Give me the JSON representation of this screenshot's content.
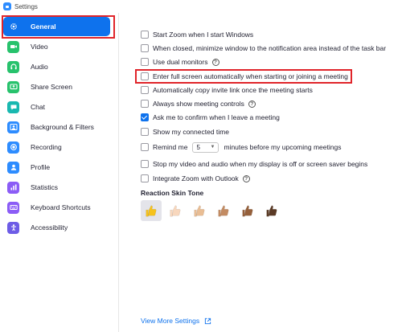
{
  "window": {
    "title": "Settings"
  },
  "sidebar": {
    "items": [
      {
        "label": "General",
        "icon": "gear-icon",
        "color": "#0e72ed",
        "active": true
      },
      {
        "label": "Video",
        "icon": "video-camera-icon",
        "color": "#27c26c"
      },
      {
        "label": "Audio",
        "icon": "headphones-icon",
        "color": "#27c26c"
      },
      {
        "label": "Share Screen",
        "icon": "share-screen-icon",
        "color": "#27c26c"
      },
      {
        "label": "Chat",
        "icon": "chat-bubble-icon",
        "color": "#19b8b0"
      },
      {
        "label": "Background & Filters",
        "icon": "person-background-icon",
        "color": "#2d8cff"
      },
      {
        "label": "Recording",
        "icon": "record-icon",
        "color": "#2d8cff"
      },
      {
        "label": "Profile",
        "icon": "profile-icon",
        "color": "#2d8cff"
      },
      {
        "label": "Statistics",
        "icon": "statistics-icon",
        "color": "#8b5cf6"
      },
      {
        "label": "Keyboard Shortcuts",
        "icon": "keyboard-icon",
        "color": "#8b5cf6"
      },
      {
        "label": "Accessibility",
        "icon": "accessibility-icon",
        "color": "#6d5ce6"
      }
    ]
  },
  "general": {
    "options": [
      {
        "label": "Start Zoom when I start Windows",
        "checked": false
      },
      {
        "label": "When closed, minimize window to the notification area instead of the task bar",
        "checked": false
      },
      {
        "label": "Use dual monitors",
        "checked": false,
        "help": true
      },
      {
        "label": "Enter full screen automatically when starting or joining a meeting",
        "checked": false
      },
      {
        "label": "Automatically copy invite link once the meeting starts",
        "checked": false
      },
      {
        "label": "Always show meeting controls",
        "checked": false,
        "help": true
      },
      {
        "label": "Ask me to confirm when I leave a meeting",
        "checked": true
      },
      {
        "label": "Show my connected time",
        "checked": false
      },
      {
        "label_before": "Remind me",
        "select_value": "5",
        "label_after": "minutes before my upcoming meetings",
        "checked": false
      },
      {
        "label": "Stop my video and audio when my display is off or screen saver begins",
        "checked": false
      },
      {
        "label": "Integrate Zoom with Outlook",
        "checked": false,
        "help": true
      }
    ],
    "help_glyph": "?",
    "reaction_skin_tone": {
      "heading": "Reaction Skin Tone",
      "tones": [
        "#f6c21c",
        "#f8d7bd",
        "#e9bd94",
        "#c38b62",
        "#95603b",
        "#5b3a25"
      ],
      "selected_index": 0
    },
    "view_more": "View More Settings"
  }
}
